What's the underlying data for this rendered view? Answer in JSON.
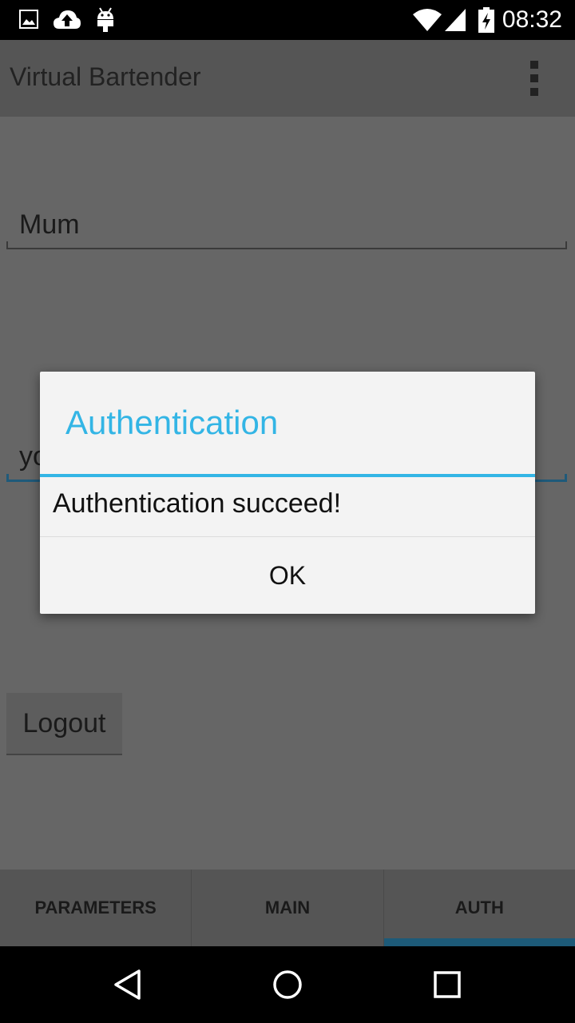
{
  "status_bar": {
    "time": "08:32",
    "icons": [
      "image-icon",
      "cloud-upload-icon",
      "android-icon",
      "wifi-icon",
      "signal-icon",
      "battery-charging-icon"
    ]
  },
  "action_bar": {
    "title": "Virtual Bartender",
    "overflow_icon": "overflow-menu-icon"
  },
  "form": {
    "username_value": "Mum",
    "password_visible_fragment": "yo",
    "logout_label": "Logout"
  },
  "tabs": [
    {
      "label": "PARAMETERS",
      "active": false
    },
    {
      "label": "MAIN",
      "active": false
    },
    {
      "label": "AUTH",
      "active": true
    }
  ],
  "dialog": {
    "title": "Authentication",
    "message": "Authentication succeed!",
    "ok_label": "OK",
    "accent_color": "#33b5e5"
  },
  "nav_bar": {
    "icons": [
      "back-icon",
      "home-icon",
      "recents-icon"
    ]
  }
}
